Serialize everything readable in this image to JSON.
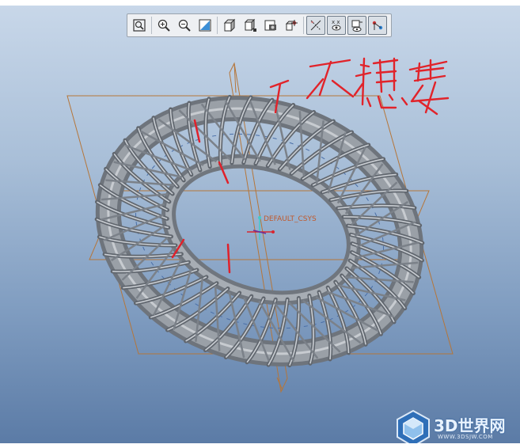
{
  "toolbar": {
    "buttons": [
      {
        "icon": "refit-icon",
        "label": "Refit"
      },
      {
        "icon": "zoom-in-icon",
        "label": "Zoom In"
      },
      {
        "icon": "zoom-out-icon",
        "label": "Zoom Out"
      },
      {
        "icon": "repaint-icon",
        "label": "Repaint"
      },
      {
        "icon": "shading-icon",
        "label": "Display Style"
      },
      {
        "icon": "saved-views-icon",
        "label": "Saved Orientations"
      },
      {
        "icon": "view-manager-icon",
        "label": "View Manager"
      },
      {
        "icon": "spin-center-icon",
        "label": "Spin Center"
      },
      {
        "icon": "datum-display-icon",
        "label": "Datum Display"
      },
      {
        "icon": "annotation-display-icon",
        "label": "Annotation Display"
      },
      {
        "icon": "perspective-icon",
        "label": "Perspective"
      },
      {
        "icon": "csys-display-icon",
        "label": "Csys Display"
      }
    ]
  },
  "viewport": {
    "csys_label": "DEFAULT_CSYS",
    "handwritten_note": "不想要",
    "model_color": "#8d9299",
    "datum_color": "#c07a3a"
  },
  "watermark": {
    "text": "3D世界网",
    "sub": "WWW.3DSJW.COM"
  }
}
